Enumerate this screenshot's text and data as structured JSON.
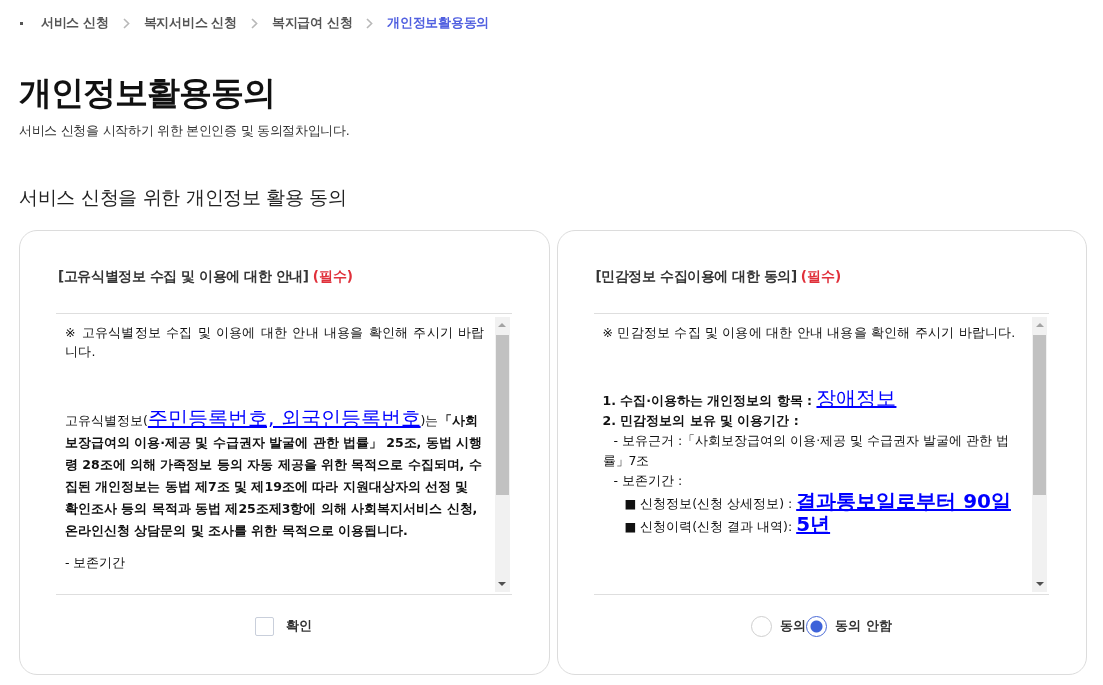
{
  "breadcrumb": [
    {
      "label": "서비스 신청",
      "current": false
    },
    {
      "label": "복지서비스 신청",
      "current": false
    },
    {
      "label": "복지급여 신청",
      "current": false
    },
    {
      "label": "개인정보활용동의",
      "current": true
    }
  ],
  "page_title": "개인정보활용동의",
  "subtitle": "서비스 신청을 시작하기 위한 본인인증 및 동의절차입니다.",
  "section_title": "서비스 신청을 위한 개인정보 활용 동의",
  "panels": [
    {
      "heading": "[고유식별정보 수집 및 이용에 대한 안내]",
      "required_label": "(필수)",
      "content": [
        {
          "kind": "note",
          "segments": [
            {
              "kind": "plain",
              "text": "※ 고유식별정보 수집 및 이용에 대한 안내 내용을 확인해 주시기 바랍니다."
            }
          ]
        },
        {
          "kind": "paragraph",
          "segments": [
            {
              "kind": "plain",
              "text": "고유식별정보("
            },
            {
              "kind": "highlight",
              "text": "주민등록번호, 외국인등록번호"
            },
            {
              "kind": "plain",
              "text": ")는"
            },
            {
              "kind": "bold",
              "text": "「사회보장급여의 이용·제공 및 수급권자 발굴에 관한 법률」 25조, 동법 시행령 28조에 의해 가족정보 등의 자동 제공을 위한 목적으로 수집되며, 수집된 개인정보는 동법 제7조 및 제19조에 따라 지원대상자의 선정 및 확인조사 등의 목적과 동법 제25조제3항에 의해 사회복지서비스 신청, 온라인신청 상담문의 및 조사를 위한 목적으로 이용됩니다."
            }
          ]
        },
        {
          "kind": "paragraph",
          "segments": [
            {
              "kind": "plain",
              "text": "- 보존기간"
            }
          ]
        }
      ],
      "control": {
        "kind": "checkbox",
        "label": "확인",
        "checked": false
      }
    },
    {
      "heading": "[민감정보 수집이용에 대한 동의]",
      "required_label": "(필수)",
      "content": [
        {
          "kind": "note",
          "segments": [
            {
              "kind": "plain",
              "text": "※ 민감정보 수집 및 이용에 대한 안내 내용을 확인해 주시기 바랍니다."
            }
          ]
        },
        {
          "kind": "line",
          "segments": [
            {
              "kind": "bold",
              "text": "1. 수집·이용하는 개인정보의 항목 : "
            },
            {
              "kind": "highlight",
              "text": "장애정보"
            }
          ]
        },
        {
          "kind": "line",
          "segments": [
            {
              "kind": "bold",
              "text": "2. 민감정보의 보유 및 이용기간 :"
            }
          ],
          "children": [
            {
              "kind": "line",
              "segments": [
                {
                  "kind": "plain",
                  "text": "- 보유근거 :「사회보장급여의 이용·제공 및 수급권자 발굴에 관한 법률」7조"
                }
              ]
            },
            {
              "kind": "line",
              "segments": [
                {
                  "kind": "plain",
                  "text": "- 보존기간 :"
                }
              ],
              "children": [
                {
                  "kind": "line",
                  "segments": [
                    {
                      "kind": "plain",
                      "text": "■ 신청정보(신청 상세정보) : "
                    },
                    {
                      "kind": "highlight-bold",
                      "text": "결과통보일로부터 90일"
                    }
                  ]
                },
                {
                  "kind": "line",
                  "segments": [
                    {
                      "kind": "plain",
                      "text": "■ 신청이력(신청 결과 내역): "
                    },
                    {
                      "kind": "highlight-bold",
                      "text": "5년"
                    }
                  ]
                }
              ]
            }
          ]
        }
      ],
      "control": {
        "kind": "radio",
        "options": [
          {
            "label": "동의",
            "selected": false
          },
          {
            "label": "동의 안함",
            "selected": true
          }
        ]
      }
    }
  ]
}
